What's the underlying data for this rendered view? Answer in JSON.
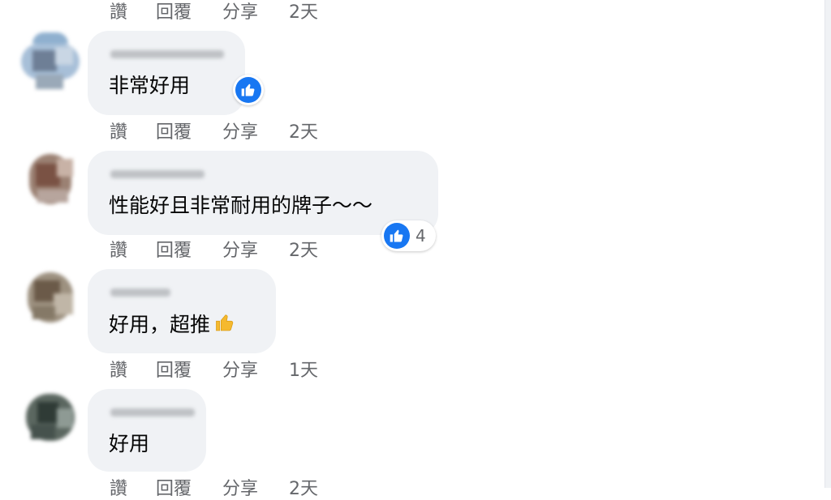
{
  "colors": {
    "bubble": "#f0f2f5",
    "action_text": "#65676b",
    "like_blue": "#1877f2",
    "thumb_emoji": "#f5b92e"
  },
  "top_actions": {
    "like": "讚",
    "reply": "回覆",
    "share": "分享",
    "time": "2天"
  },
  "comments": [
    {
      "text": "非常好用",
      "reaction": {
        "icon": "like-icon",
        "count": ""
      },
      "actions": {
        "like": "讚",
        "reply": "回覆",
        "share": "分享",
        "time": "2天"
      }
    },
    {
      "text": "性能好且非常耐用的牌子～～",
      "reaction": {
        "icon": "like-icon",
        "count": "4"
      },
      "actions": {
        "like": "讚",
        "reply": "回覆",
        "share": "分享",
        "time": "2天"
      }
    },
    {
      "text": "好用，超推",
      "emoji": "thumbs-up-emoji",
      "actions": {
        "like": "讚",
        "reply": "回覆",
        "share": "分享",
        "time": "1天"
      }
    },
    {
      "text": "好用",
      "actions": {
        "like": "讚",
        "reply": "回覆",
        "share": "分享",
        "time": "2天"
      }
    }
  ]
}
